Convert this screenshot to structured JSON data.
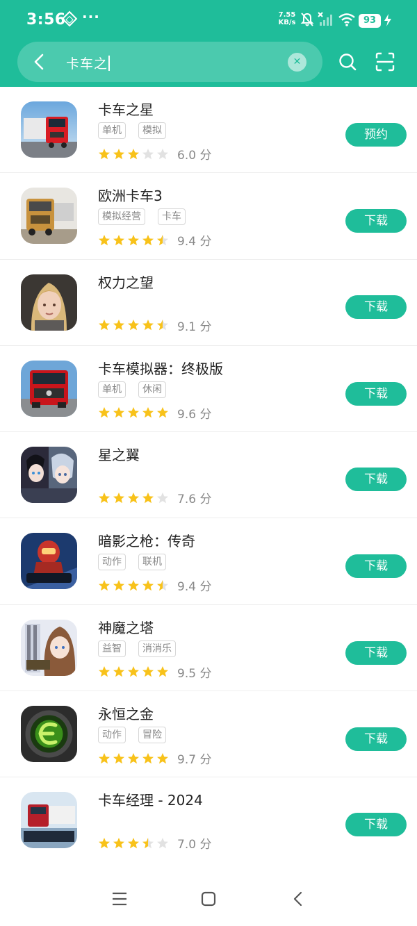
{
  "status_bar": {
    "time": "3:56",
    "net_speed_value": "7.55",
    "net_speed_unit": "KB/s",
    "battery": "93",
    "icons": [
      "diamond-icon",
      "more-dots-icon",
      "mute-bell-icon",
      "no-signal-icon",
      "wifi-icon",
      "battery-icon",
      "charging-icon"
    ]
  },
  "search": {
    "query": "卡车之",
    "back_icon": "chevron-left-icon",
    "clear_icon": "clear-icon",
    "search_icon": "search-icon",
    "scan_icon": "scan-icon"
  },
  "colors": {
    "accent": "#1fbd9a",
    "star": "#f8c21a",
    "star_empty": "#e2e2e2"
  },
  "apps": [
    {
      "name": "卡车之星",
      "tags": [
        "单机",
        "模拟"
      ],
      "stars": 3,
      "score": "6.0 分",
      "action": "预约"
    },
    {
      "name": "欧洲卡车3",
      "tags": [
        "模拟经营",
        "卡车"
      ],
      "stars": 4.5,
      "score": "9.4 分",
      "action": "下载"
    },
    {
      "name": "权力之望",
      "tags": [],
      "stars": 4.5,
      "score": "9.1 分",
      "action": "下载"
    },
    {
      "name": "卡车模拟器：终极版",
      "tags": [
        "单机",
        "休闲"
      ],
      "stars": 5,
      "score": "9.6 分",
      "action": "下载"
    },
    {
      "name": "星之翼",
      "tags": [],
      "stars": 4,
      "score": "7.6 分",
      "action": "下载"
    },
    {
      "name": "暗影之枪：传奇",
      "tags": [
        "动作",
        "联机"
      ],
      "stars": 4.5,
      "score": "9.4 分",
      "action": "下载"
    },
    {
      "name": "神魔之塔",
      "tags": [
        "益智",
        "消消乐"
      ],
      "stars": 5,
      "score": "9.5 分",
      "action": "下载"
    },
    {
      "name": "永恒之金",
      "tags": [
        "动作",
        "冒险"
      ],
      "stars": 5,
      "score": "9.7 分",
      "action": "下载"
    },
    {
      "name": "卡车经理 - 2024",
      "tags": [],
      "stars": 3.5,
      "score": "7.0 分",
      "action": "下载"
    }
  ],
  "nav_bar": {
    "icons": [
      "menu-icon",
      "home-icon",
      "back-icon"
    ]
  }
}
